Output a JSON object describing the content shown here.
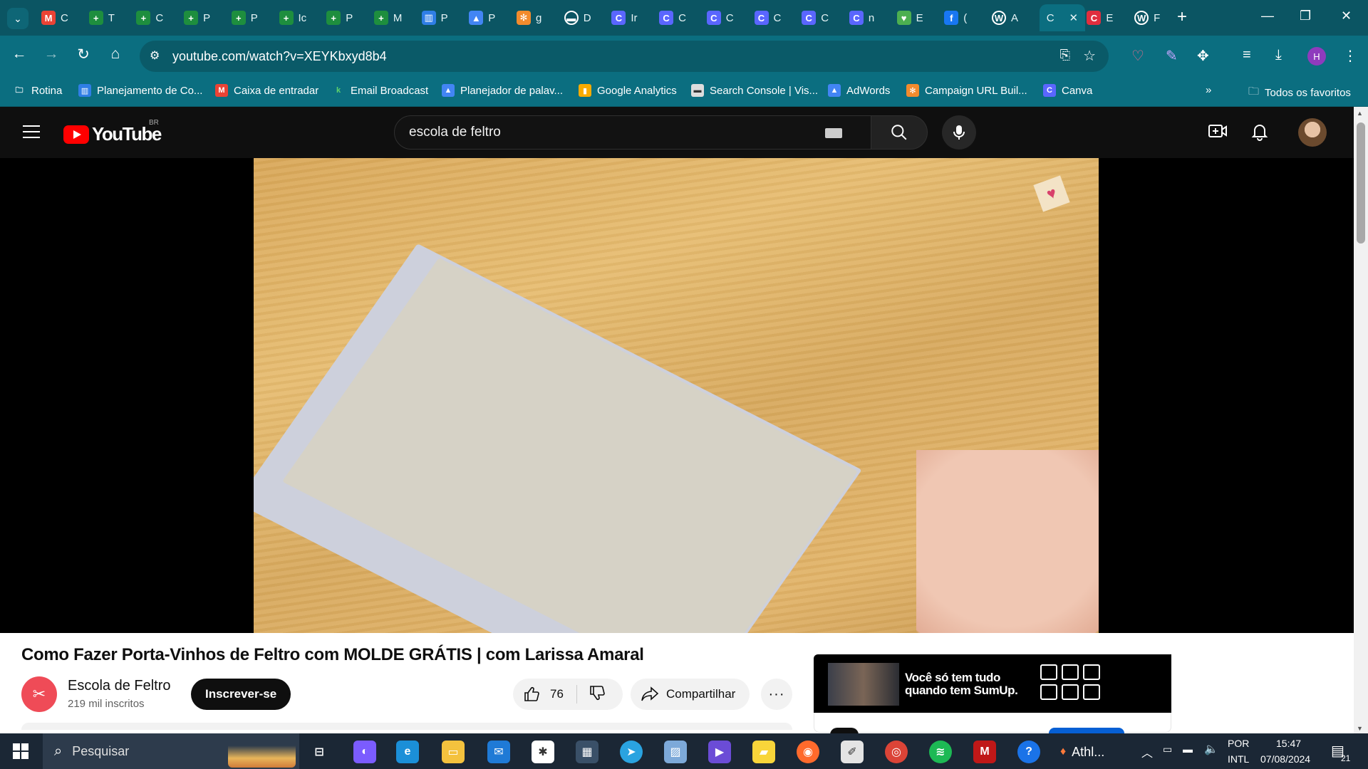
{
  "tabs": [
    {
      "label": "C",
      "icon": "gmail-icon",
      "color": "#ea4335",
      "glyph": "M"
    },
    {
      "label": "T",
      "icon": "sheets-plus-icon",
      "color": "#1e8e3e",
      "glyph": "+"
    },
    {
      "label": "C",
      "icon": "sheets-plus-icon",
      "color": "#1e8e3e",
      "glyph": "+"
    },
    {
      "label": "P",
      "icon": "sheets-plus-icon",
      "color": "#1e8e3e",
      "glyph": "+"
    },
    {
      "label": "P",
      "icon": "sheets-plus-icon",
      "color": "#1e8e3e",
      "glyph": "+"
    },
    {
      "label": "Ic",
      "icon": "sheets-plus-icon",
      "color": "#1e8e3e",
      "glyph": "+"
    },
    {
      "label": "P",
      "icon": "sheets-plus-icon",
      "color": "#1e8e3e",
      "glyph": "+"
    },
    {
      "label": "M",
      "icon": "sheets-plus-icon",
      "color": "#1e8e3e",
      "glyph": "+"
    },
    {
      "label": "P",
      "icon": "trello-icon",
      "color": "#2f7ee6",
      "glyph": "▥"
    },
    {
      "label": "P",
      "icon": "adwords-icon",
      "color": "#4285f4",
      "glyph": "▲"
    },
    {
      "label": "g",
      "icon": "gear-orange-icon",
      "color": "#f28b2d",
      "glyph": "✻"
    },
    {
      "label": "D",
      "icon": "dashboard-icon",
      "color": "#dddddd",
      "glyph": "▬"
    },
    {
      "label": "Ir",
      "icon": "canva-icon",
      "color": "#5a66ff",
      "glyph": "C"
    },
    {
      "label": "C",
      "icon": "canva-icon",
      "color": "#5a66ff",
      "glyph": "C"
    },
    {
      "label": "C",
      "icon": "canva-icon",
      "color": "#5a66ff",
      "glyph": "C"
    },
    {
      "label": "C",
      "icon": "canva-icon",
      "color": "#5a66ff",
      "glyph": "C"
    },
    {
      "label": "C",
      "icon": "canva-icon",
      "color": "#5a66ff",
      "glyph": "C"
    },
    {
      "label": "n",
      "icon": "canva-icon",
      "color": "#5a66ff",
      "glyph": "C"
    },
    {
      "label": "E",
      "icon": "heart-green-icon",
      "color": "#4caf50",
      "glyph": "♥"
    },
    {
      "label": "(",
      "icon": "facebook-icon",
      "color": "#1877f2",
      "glyph": "f"
    },
    {
      "label": "A",
      "icon": "wordpress-icon",
      "color": "#ffffff",
      "glyph": "W"
    },
    {
      "label": "C",
      "icon": "tab-active",
      "color": "#0b6e80",
      "glyph": ""
    },
    {
      "label": "E",
      "icon": "eduzz-icon",
      "color": "#e02e3e",
      "glyph": "C"
    },
    {
      "label": "F",
      "icon": "wordpress-icon",
      "color": "#ffffff",
      "glyph": "W"
    }
  ],
  "address": {
    "url": "youtube.com/watch?v=XEYKbxyd8b4"
  },
  "bookmarks": [
    {
      "label": "Rotina",
      "icon": "folder-icon"
    },
    {
      "label": "Planejamento de Co...",
      "icon": "trello-icon"
    },
    {
      "label": "Caixa de entradar",
      "icon": "gmail-icon"
    },
    {
      "label": "Email Broadcast",
      "icon": "klickpages-icon"
    },
    {
      "label": "Planejador de palav...",
      "icon": "adwords-icon"
    },
    {
      "label": "Google Analytics",
      "icon": "analytics-icon"
    },
    {
      "label": "Search Console | Vis...",
      "icon": "search-console-icon"
    },
    {
      "label": "AdWords",
      "icon": "adwords-icon"
    },
    {
      "label": "Campaign URL Buil...",
      "icon": "campaign-icon"
    },
    {
      "label": "Canva",
      "icon": "canva-icon"
    }
  ],
  "bookmarks_all": "Todos os favoritos",
  "youtube": {
    "logo_word": "YouTube",
    "country": "BR",
    "search_value": "escola de feltro"
  },
  "video": {
    "title": "Como Fazer Porta-Vinhos de Feltro com MOLDE GRÁTIS | com Larissa Amaral",
    "channel": "Escola de Feltro",
    "subscribers": "219 mil inscritos",
    "subscribe_label": "Inscrever-se",
    "likes": "76",
    "share_label": "Compartilhar"
  },
  "ad": {
    "text": "Você só tem tudo quando tem SumUp."
  },
  "taskbar": {
    "search_label": "Pesquisar",
    "athl_label": "Athl...",
    "lang_top": "POR",
    "lang_bottom": "INTL",
    "time": "15:47",
    "date": "07/08/2024",
    "notifications": "21"
  },
  "colors": {
    "chrome_dark": "#0b5563",
    "chrome_toolbar": "#0b6e80",
    "youtube_red": "#ff0000",
    "taskbar": "#1b2735"
  }
}
